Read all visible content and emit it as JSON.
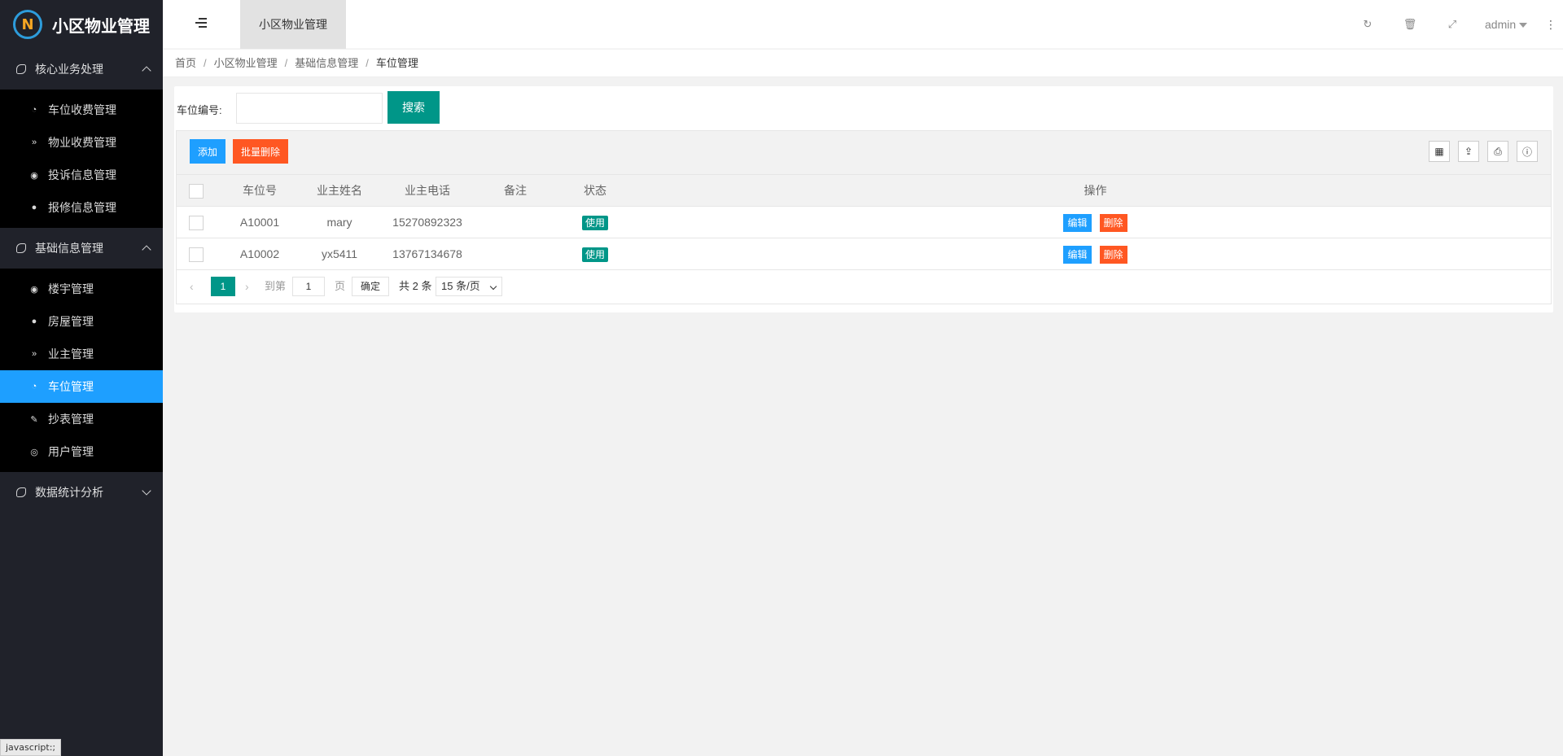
{
  "brand": {
    "logo_text": "小区物业管理",
    "logo_glyph": "N"
  },
  "sidebar": {
    "groups": [
      {
        "title": "核心业务处理",
        "expanded": true,
        "items": [
          {
            "label": "车位收费管理",
            "icon": "dashboard-icon"
          },
          {
            "label": "物业收费管理",
            "icon": "double-chevron-icon"
          },
          {
            "label": "投诉信息管理",
            "icon": "target-icon"
          },
          {
            "label": "报修信息管理",
            "icon": "circle-up-icon"
          }
        ]
      },
      {
        "title": "基础信息管理",
        "expanded": true,
        "items": [
          {
            "label": "楼宇管理",
            "icon": "target-icon"
          },
          {
            "label": "房屋管理",
            "icon": "circle-up-icon"
          },
          {
            "label": "业主管理",
            "icon": "double-chevron-icon"
          },
          {
            "label": "车位管理",
            "icon": "dashboard-icon",
            "active": true
          },
          {
            "label": "抄表管理",
            "icon": "edit-icon"
          },
          {
            "label": "用户管理",
            "icon": "user-circle-icon"
          }
        ]
      },
      {
        "title": "数据统计分析",
        "expanded": false,
        "items": []
      }
    ]
  },
  "header": {
    "tab_label": "小区物业管理",
    "user": "admin",
    "tools": [
      "refresh-icon",
      "trash-icon",
      "fullscreen-icon"
    ]
  },
  "breadcrumb": [
    "首页",
    "小区物业管理",
    "基础信息管理",
    "车位管理"
  ],
  "search": {
    "label": "车位编号:",
    "value": "",
    "button": "搜索"
  },
  "toolbar": {
    "add": "添加",
    "batch_delete": "批量删除",
    "icons": [
      "columns-icon",
      "export-icon",
      "print-icon",
      "info-icon"
    ]
  },
  "table": {
    "columns": [
      "车位号",
      "业主姓名",
      "业主电话",
      "备注",
      "状态",
      "操作"
    ],
    "rows": [
      {
        "code": "A10001",
        "owner": "mary",
        "phone": "15270892323",
        "note": "",
        "status": "使用",
        "edit": "编辑",
        "delete": "删除"
      },
      {
        "code": "A10002",
        "owner": "yx5411",
        "phone": "13767134678",
        "note": "",
        "status": "使用",
        "edit": "编辑",
        "delete": "删除"
      }
    ]
  },
  "pager": {
    "current": "1",
    "goto": "到第",
    "page_input": "1",
    "page_unit": "页",
    "confirm": "确定",
    "total": "共 2 条",
    "page_size": "15 条/页"
  },
  "status_bar": "javascript:;",
  "colors": {
    "accent": "#009688",
    "primary": "#1e9fff",
    "danger": "#ff5722",
    "sidebar": "#20222a"
  }
}
